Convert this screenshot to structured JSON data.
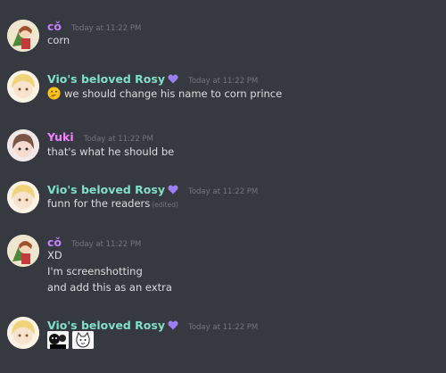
{
  "colors": {
    "rosy_name": "#7fe0c6",
    "co_name": "#c77dff",
    "yuki_name": "#f47fff",
    "heart": "#9b7ff2"
  },
  "messages": [
    {
      "author": "cǒ",
      "timestamp": "Today at 11:22 PM",
      "lines": [
        "corn"
      ]
    },
    {
      "author": "Vio's beloved Rosy",
      "timestamp": "Today at 11:22 PM",
      "emoji": "thinking-face",
      "lines": [
        "we should change his name to corn prince"
      ]
    },
    {
      "author": "Yuki",
      "timestamp": "Today at 11:22 PM",
      "lines": [
        "that's what he should be"
      ]
    },
    {
      "author": "Vio's beloved Rosy",
      "timestamp": "Today at 11:22 PM",
      "lines": [
        "funn for the readers"
      ],
      "edited": "(edited)"
    },
    {
      "author": "cǒ",
      "timestamp": "Today at 11:22 PM",
      "lines": [
        "XD",
        "I'm screenshotting",
        "and add this as an extra"
      ]
    },
    {
      "author": "Vio's beloved Rosy",
      "timestamp": "Today at 11:22 PM",
      "stickers": [
        "meme-sticker",
        "cat-sticker"
      ]
    }
  ]
}
